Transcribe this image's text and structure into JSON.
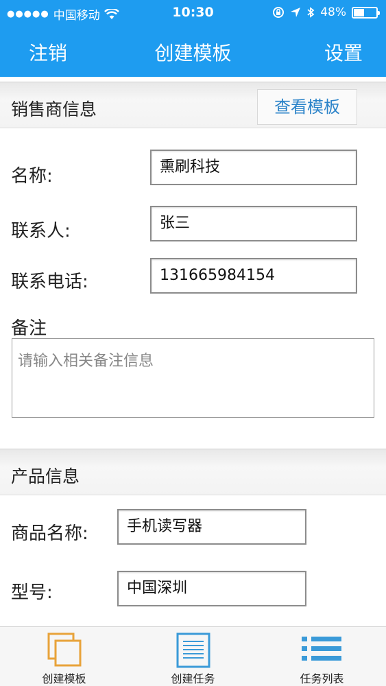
{
  "status_bar": {
    "carrier": "中国移动",
    "time": "10:30",
    "battery": "48%",
    "battery_level": 0.48
  },
  "nav": {
    "left_label": "注销",
    "title": "创建模板",
    "right_label": "设置"
  },
  "dealer_section": {
    "title": "销售商信息",
    "view_button": "查看模板",
    "fields": {
      "name_label": "名称:",
      "name_value": "熏刷科技",
      "contact_label": "联系人:",
      "contact_value": "张三",
      "phone_label": "联系电话:",
      "phone_value": "131665984154",
      "note_label": "备注",
      "note_placeholder": "请输入相关备注信息"
    }
  },
  "product_section": {
    "title": "产品信息",
    "fields": {
      "product_name_label": "商品名称:",
      "product_name_value": "手机读写器",
      "model_label": "型号:",
      "model_value": "中国深圳"
    }
  },
  "tab_bar": {
    "tabs": [
      {
        "label": "创建模板",
        "icon": "copy-icon"
      },
      {
        "label": "创建任务",
        "icon": "document-icon"
      },
      {
        "label": "任务列表",
        "icon": "list-icon"
      }
    ],
    "colors": {
      "accent_blue": "#1e9cf0",
      "icon_orange": "#e8a33a",
      "icon_blue": "#3a9ad8"
    }
  }
}
